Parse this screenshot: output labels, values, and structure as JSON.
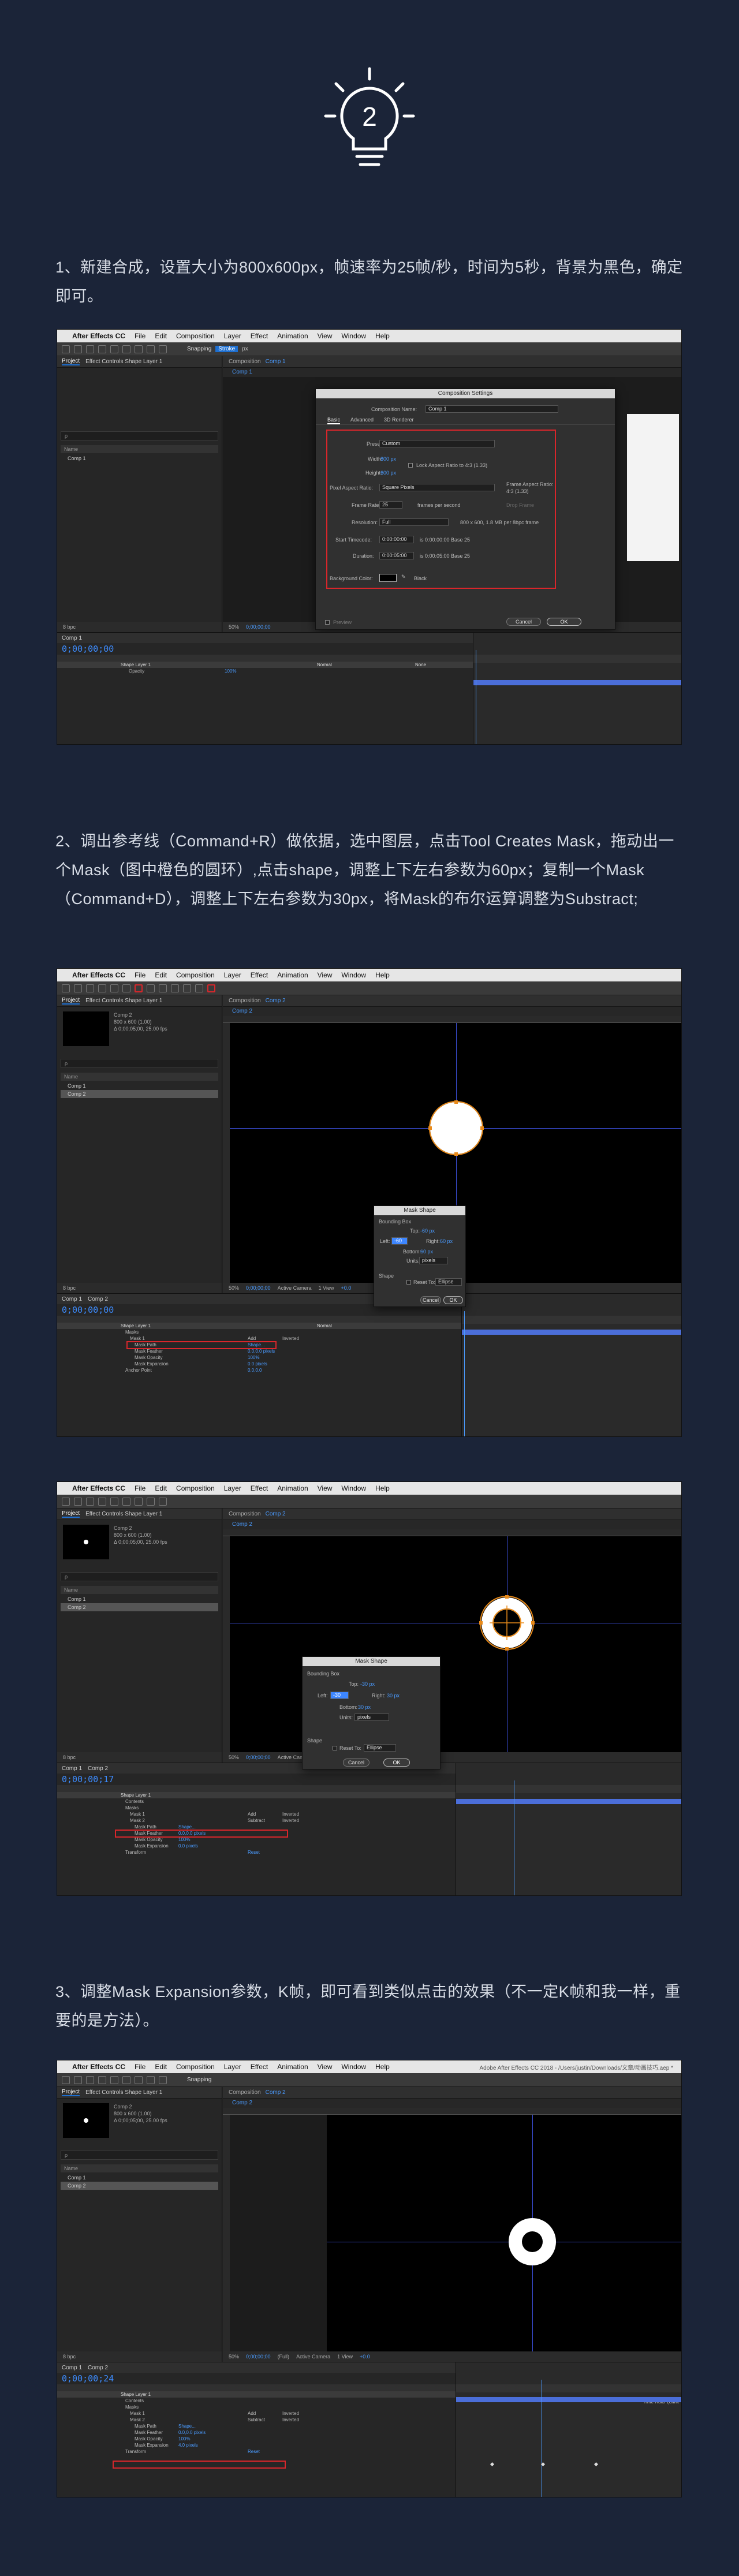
{
  "badge_number": "2",
  "steps": [
    "1、新建合成，设置大小为800x600px，帧速率为25帧/秒，时间为5秒，背景为黑色，确定即可。",
    "2、调出参考线（Command+R）做依据，选中图层，点击Tool Creates Mask，拖动出一个Mask（图中橙色的圆环）,点击shape，调整上下左右参数为60px；复制一个Mask（Command+D），调整上下左右参数为30px，将Mask的布尔运算调整为Substract;",
    "3、调整Mask Expansion参数，K帧，即可看到类似点击的效果（不一定K帧和我一样，重要的是方法）。"
  ],
  "menubar": {
    "apple": "",
    "app": "After Effects CC",
    "items": [
      "File",
      "Edit",
      "Composition",
      "Layer",
      "Effect",
      "Animation",
      "View",
      "Window",
      "Help"
    ],
    "title_4": "Adobe After Effects CC 2018 - /Users/justin/Downloads/文章/动画技巧.aep *"
  },
  "toolbar": {
    "snapping": "Snapping",
    "stroke": "Stroke",
    "px": "px",
    "swatch": ""
  },
  "panels": {
    "project_tab": "Project",
    "effect_controls": "Effect Controls Shape Layer 1",
    "composition_tab": "Composition",
    "comp_name": "Comp 1",
    "comp_meta": [
      "800 x 600 (1.00)",
      "Δ 0;00;05;00, 25.00 fps"
    ],
    "search_placeholder": "ρ",
    "name_header": "Name",
    "rows": [
      "Comp 1",
      "Comp 2"
    ],
    "bpc": "8 bpc",
    "zoom": "50%",
    "timecode": "0;00;00;00",
    "full": "(Full)",
    "active_camera": "Active Camera",
    "view": "1 View",
    "offset": "+0.0"
  },
  "shot1": {
    "dialog_title": "Composition Settings",
    "comp_name_label": "Composition Name:",
    "comp_name_value": "Comp 1",
    "tabs": [
      "Basic",
      "Advanced",
      "3D Renderer"
    ],
    "preset_label": "Preset:",
    "preset_value": "Custom",
    "width_label": "Width:",
    "width_value": "800 px",
    "height_label": "Height:",
    "height_value": "600 px",
    "lock_label": "Lock Aspect Ratio to 4:3 (1.33)",
    "par_label": "Pixel Aspect Ratio:",
    "par_value": "Square Pixels",
    "far_label": "Frame Aspect Ratio:",
    "far_value": "4:3 (1.33)",
    "fr_label": "Frame Rate:",
    "fr_value": "25",
    "fr_unit": "frames per second",
    "drop_frame": "Drop Frame",
    "res_label": "Resolution:",
    "res_value": "Full",
    "res_info": "800 x 600, 1.8 MB per 8bpc frame",
    "start_label": "Start Timecode:",
    "start_value": "0:00:00:00",
    "start_info": "is 0:00:00:00  Base 25",
    "dur_label": "Duration:",
    "dur_value": "0:00:05:00",
    "dur_info": "is 0:00:05:00  Base 25",
    "bg_label": "Background Color:",
    "bg_name": "Black",
    "preview": "Preview",
    "cancel": "Cancel",
    "ok": "OK",
    "timeline_time": "0;00;00;00",
    "layer_name": "Shape Layer 1",
    "opacity_label": "Opacity",
    "opacity_value": "100%",
    "mode": "Normal",
    "parent": "None"
  },
  "shot2": {
    "dialog_title": "Mask Shape",
    "bbox_label": "Bounding Box",
    "top_label": "Top:",
    "top_value": "-60 px",
    "left_label": "Left:",
    "left_value": "-60",
    "right_label": "Right:",
    "right_value": "60 px",
    "bottom_label": "Bottom:",
    "bottom_value": "60 px",
    "units_label": "Units:",
    "units_value": "pixels",
    "shape_label": "Shape",
    "reset_label": "Reset To:",
    "reset_value": "Ellipse",
    "cancel": "Cancel",
    "ok": "OK",
    "timeline_time": "0;00;00;00",
    "tl_rows": [
      "Contents",
      "Masks",
      "Mask 1",
      "Mask Path",
      "Mask Feather",
      "Mask Opacity",
      "Mask Expansion",
      "Transform",
      "Anchor Point"
    ],
    "tl_vals": [
      "",
      "",
      "Add",
      "Shape...",
      "0.0,0.0 pixels",
      "100%",
      "0.0 pixels",
      "Reset",
      "0.0,0.0"
    ],
    "inverted": "Inverted"
  },
  "shot3": {
    "dialog_title": "Mask Shape",
    "bbox_label": "Bounding Box",
    "top_value": "-30 px",
    "left_value": "-30",
    "right_value": "30 px",
    "bottom_value": "30 px",
    "units_value": "pixels",
    "reset_value": "Ellipse",
    "timeline_time": "0;00;00;17",
    "mask1": "Mask 1",
    "mask2": "Mask 2",
    "mask2_mode": "Subtract",
    "tl_rows": [
      "Contents",
      "Masks",
      "Mask 1",
      "Mask 2",
      "Mask Path",
      "Mask Feather",
      "Mask Opacity",
      "Mask Expansion",
      "Transform"
    ],
    "tl_vals": [
      "",
      "",
      "Add",
      "Subtract",
      "Shape...",
      "0.0,0.0 pixels",
      "100%",
      "0.0 pixels",
      "Reset"
    ]
  },
  "shot4": {
    "timeline_time": "0;00;00;24",
    "tl_rows": [
      "Contents",
      "Masks",
      "Mask 1",
      "Mask 2",
      "Mask Path",
      "Mask Feather",
      "Mask Opacity",
      "Mask Expansion",
      "Transform"
    ],
    "tl_vals": [
      "",
      "",
      "Add",
      "Subtract",
      "Shape...",
      "0.0,0.0 pixels",
      "100%",
      "4.0 pixels",
      "Reset"
    ],
    "time_ruler": "Time Ruler (Clink"
  }
}
